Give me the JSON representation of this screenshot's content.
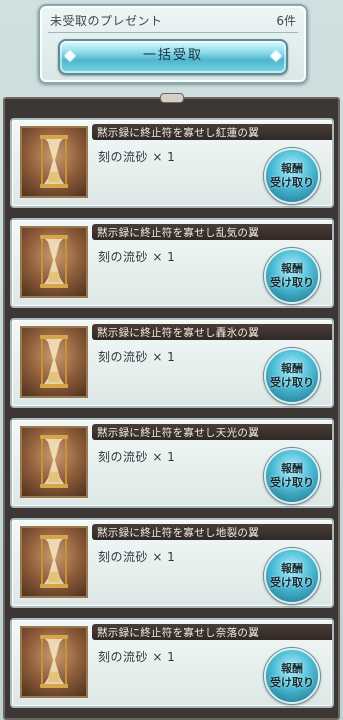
{
  "header": {
    "title": "未受取のプレゼント",
    "count": "6件",
    "claim_all_label": "一括受取"
  },
  "gifts": [
    {
      "title": "黙示録に終止符を寡せし紅蓮の翼",
      "item": "刻の流砂 × 1",
      "button_line1": "報酬",
      "button_line2": "受け取り"
    },
    {
      "title": "黙示録に終止符を寡せし乱気の翼",
      "item": "刻の流砂 × 1",
      "button_line1": "報酬",
      "button_line2": "受け取り"
    },
    {
      "title": "黙示録に終止符を寡せし轟氷の翼",
      "item": "刻の流砂 × 1",
      "button_line1": "報酬",
      "button_line2": "受け取り"
    },
    {
      "title": "黙示録に終止符を寡せし天光の翼",
      "item": "刻の流砂 × 1",
      "button_line1": "報酬",
      "button_line2": "受け取り"
    },
    {
      "title": "黙示録に終止符を寡せし地裂の翼",
      "item": "刻の流砂 × 1",
      "button_line1": "報酬",
      "button_line2": "受け取り"
    },
    {
      "title": "黙示録に終止符を寡せし奈落の翼",
      "item": "刻の流砂 × 1",
      "button_line1": "報酬",
      "button_line2": "受け取り"
    }
  ],
  "item_icon": "hourglass-icon"
}
